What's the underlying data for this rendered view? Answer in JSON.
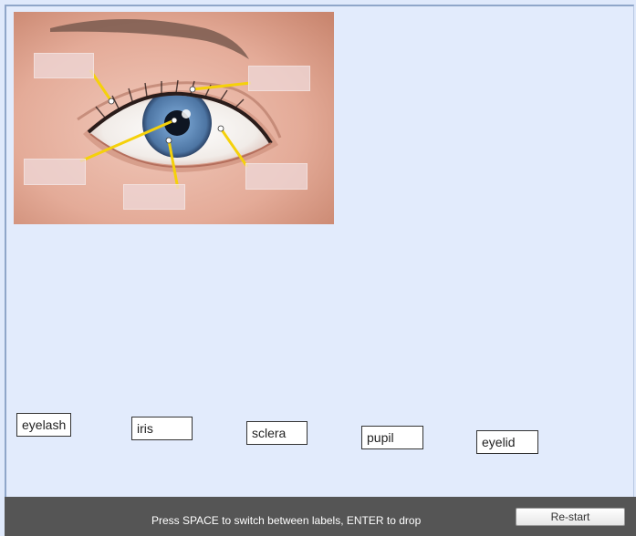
{
  "labels": [
    {
      "id": "eyelash",
      "text": "eyelash"
    },
    {
      "id": "iris",
      "text": "iris"
    },
    {
      "id": "sclera",
      "text": "sclera"
    },
    {
      "id": "pupil",
      "text": "pupil"
    },
    {
      "id": "eyelid",
      "text": "eyelid"
    }
  ],
  "footer": {
    "instruction": "Press SPACE to switch between labels, ENTER to drop",
    "restart_label": "Re-start"
  },
  "colors": {
    "background": "#e2ebfc",
    "footer": "#555555",
    "pointer_line": "#f5d10a",
    "iris": "#5f88b7",
    "skin": "#e9b7a6"
  },
  "icons": {
    "eye_illustration": "eye-illustration"
  }
}
